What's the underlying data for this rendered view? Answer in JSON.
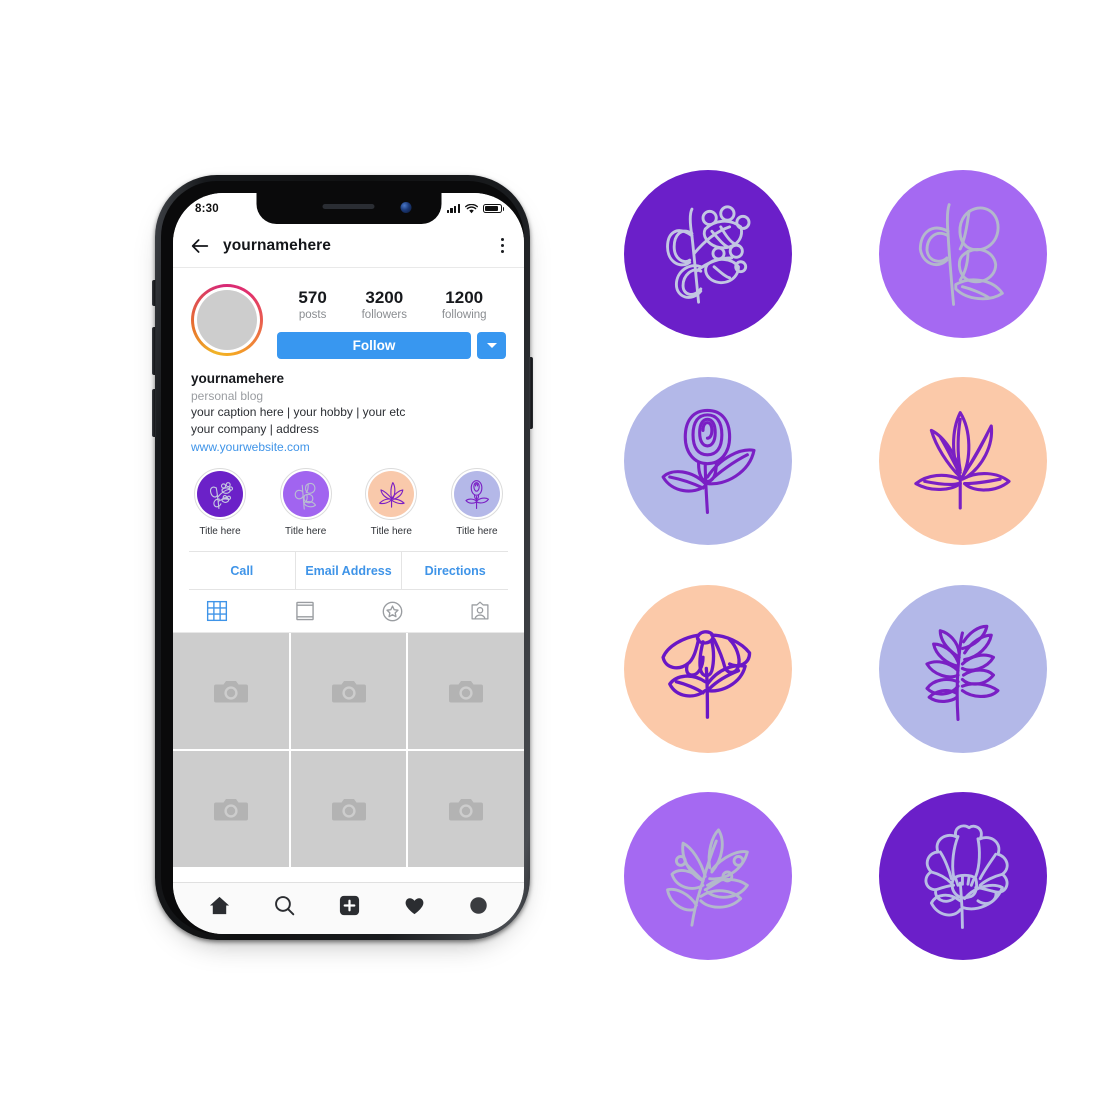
{
  "phone": {
    "status_bar": {
      "time": "8:30",
      "signal_icon": "signal-bars-icon",
      "wifi_icon": "wifi-icon",
      "battery_icon": "battery-icon"
    },
    "header": {
      "back_icon": "back-arrow-icon",
      "title": "yournamehere",
      "menu_icon": "kebab-menu-icon"
    },
    "profile": {
      "avatar_label": "profile-avatar",
      "stats": [
        {
          "value": "570",
          "label": "posts"
        },
        {
          "value": "3200",
          "label": "followers"
        },
        {
          "value": "1200",
          "label": "following"
        }
      ],
      "follow_label": "Follow",
      "dropdown_icon": "chevron-down-icon"
    },
    "bio": {
      "name": "yournamehere",
      "category": "personal blog",
      "line1": "your caption here  | your hobby | your etc",
      "line2": "your company | address",
      "website": "www.yourwebsite.com"
    },
    "highlights": [
      {
        "title": "Title here",
        "bg": "#6b21c8",
        "stroke": "#c5c9e0",
        "art": "berry-branch"
      },
      {
        "title": "Title here",
        "bg": "#a濃",
        "bg_hex": "#a164f0",
        "stroke": "#b9bdd2",
        "art": "bud-branch"
      },
      {
        "title": "Title here",
        "bg": "#f9c9ab",
        "stroke": "#7b20c4",
        "art": "fan-leaf"
      },
      {
        "title": "Title here",
        "bg": "#b4b8e8",
        "stroke": "#7b20c4",
        "art": "rose"
      }
    ],
    "action_buttons": [
      "Call",
      "Email Address",
      "Directions"
    ],
    "tabs": [
      {
        "icon": "grid-icon",
        "active": true
      },
      {
        "icon": "reels-frame-icon",
        "active": false
      },
      {
        "icon": "star-circle-icon",
        "active": false
      },
      {
        "icon": "tagged-portrait-icon",
        "active": false
      }
    ],
    "grid_cells": [
      "camera-placeholder",
      "camera-placeholder",
      "camera-placeholder",
      "camera-placeholder",
      "camera-placeholder",
      "camera-placeholder"
    ],
    "bottom_nav": [
      {
        "icon": "home-icon"
      },
      {
        "icon": "search-icon"
      },
      {
        "icon": "add-post-icon"
      },
      {
        "icon": "heart-icon"
      },
      {
        "icon": "profile-dot-icon"
      }
    ]
  },
  "gallery": {
    "icons": [
      {
        "name": "berry-branch-icon",
        "bg": "#6b1fc9",
        "stroke": "#c2c6e2",
        "art": "berry-branch"
      },
      {
        "name": "bud-branch-icon",
        "bg": "#a569f2",
        "stroke": "#b3b8cc",
        "art": "bud-branch"
      },
      {
        "name": "rose-icon",
        "bg": "#b3b8e8",
        "stroke": "#7a1fc4",
        "art": "rose"
      },
      {
        "name": "fan-leaf-icon",
        "bg": "#fbc9a9",
        "stroke": "#7a1fc4",
        "art": "fan-leaf"
      },
      {
        "name": "daisy-icon",
        "bg": "#fbc9a9",
        "stroke": "#6a17c6",
        "art": "daisy"
      },
      {
        "name": "fern-sprig-icon",
        "bg": "#b3b8e8",
        "stroke": "#7a1fc4",
        "art": "fern-sprig"
      },
      {
        "name": "leafy-sprig-icon",
        "bg": "#a569f2",
        "stroke": "#b3b8cc",
        "art": "leafy-sprig"
      },
      {
        "name": "carnation-icon",
        "bg": "#6b1fc9",
        "stroke": "#b8bde4",
        "art": "carnation"
      }
    ]
  },
  "colors": {
    "instagram_blue": "#3897f0",
    "deep_purple": "#6b1fc9",
    "medium_purple": "#a569f2",
    "periwinkle": "#b3b8e8",
    "peach": "#fbc9a9",
    "line_purple": "#7a1fc4",
    "line_lavender": "#c2c6e2"
  }
}
